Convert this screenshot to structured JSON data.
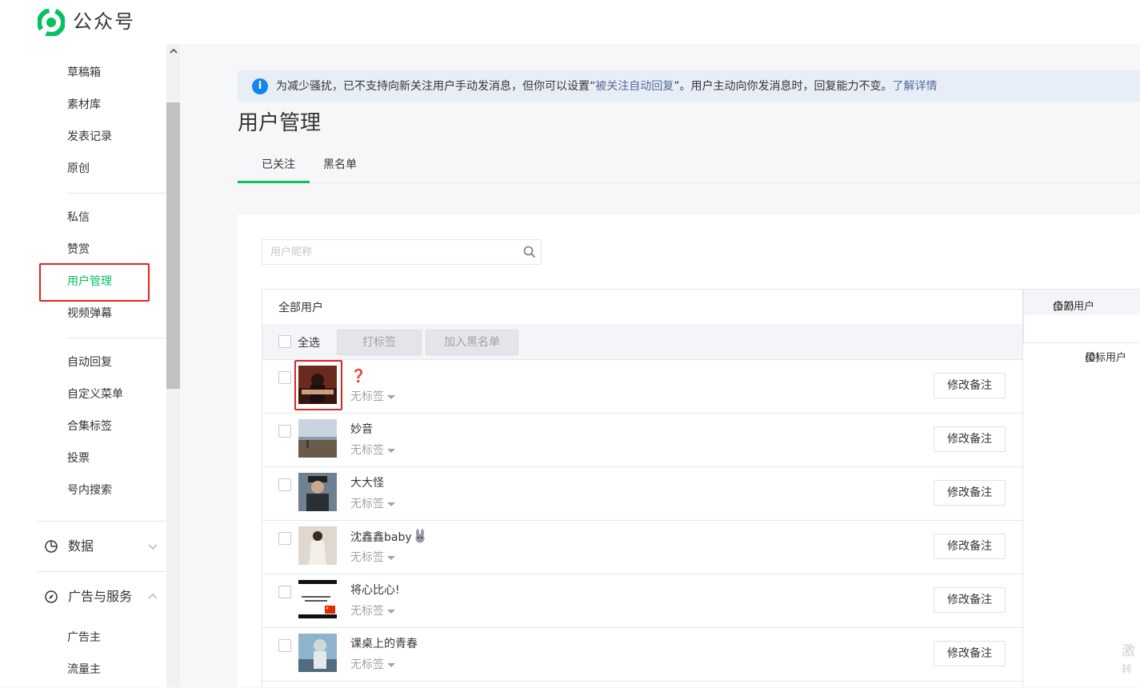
{
  "header": {
    "brand": "公众号"
  },
  "sidebar": {
    "items": [
      {
        "label": "草稿箱",
        "active": false
      },
      {
        "label": "素材库",
        "active": false
      },
      {
        "label": "发表记录",
        "active": false
      },
      {
        "label": "原创",
        "active": false
      },
      {
        "label": "私信",
        "active": false
      },
      {
        "label": "赞赏",
        "active": false
      },
      {
        "label": "用户管理",
        "active": true
      },
      {
        "label": "视频弹幕",
        "active": false
      },
      {
        "label": "自动回复",
        "active": false
      },
      {
        "label": "自定义菜单",
        "active": false
      },
      {
        "label": "合集标签",
        "active": false
      },
      {
        "label": "投票",
        "active": false
      },
      {
        "label": "号内搜索",
        "active": false
      }
    ],
    "groups": [
      {
        "label": "数据",
        "icon": "chart-clock-icon",
        "expanded": false
      },
      {
        "label": "广告与服务",
        "icon": "compass-icon",
        "expanded": true
      }
    ],
    "sub_items": [
      {
        "label": "广告主"
      },
      {
        "label": "流量主"
      }
    ]
  },
  "notice": {
    "text_before": "为减少骚扰，已不支持向新关注用户手动发消息，但你可以设置“",
    "link_setting": "被关注自动回复",
    "text_after": "”。用户主动向你发消息时，回复能力不变。",
    "link_more": "了解详情"
  },
  "page": {
    "title": "用户管理",
    "tabs": [
      {
        "label": "已关注",
        "active": true
      },
      {
        "label": "黑名单",
        "active": false
      }
    ]
  },
  "search": {
    "placeholder": "用户昵称",
    "value": ""
  },
  "list": {
    "header": "全部用户",
    "select_all": "全选",
    "btn_tag": "打标签",
    "btn_blacklist": "加入黑名单",
    "remark_label": "修改备注",
    "users": [
      {
        "nickname": "❓",
        "tag": "无标签"
      },
      {
        "nickname": "妙音",
        "tag": "无标签"
      },
      {
        "nickname": "大大怪",
        "tag": "无标签"
      },
      {
        "nickname": "沈鑫鑫baby",
        "tag": "无标签"
      },
      {
        "nickname": "将心比心!",
        "tag": "无标签"
      },
      {
        "nickname": "课桌上的青春",
        "tag": "无标签"
      }
    ]
  },
  "filters": {
    "all_label": "全部用户",
    "all_count": "(57)",
    "star_label": "星标用户",
    "star_count": "(0)"
  },
  "watermark": {
    "line1": "激",
    "line2": "转"
  },
  "colors": {
    "accent": "#07c160",
    "link": "#576b95",
    "highlight": "#e0251f",
    "info": "#1485ee"
  }
}
